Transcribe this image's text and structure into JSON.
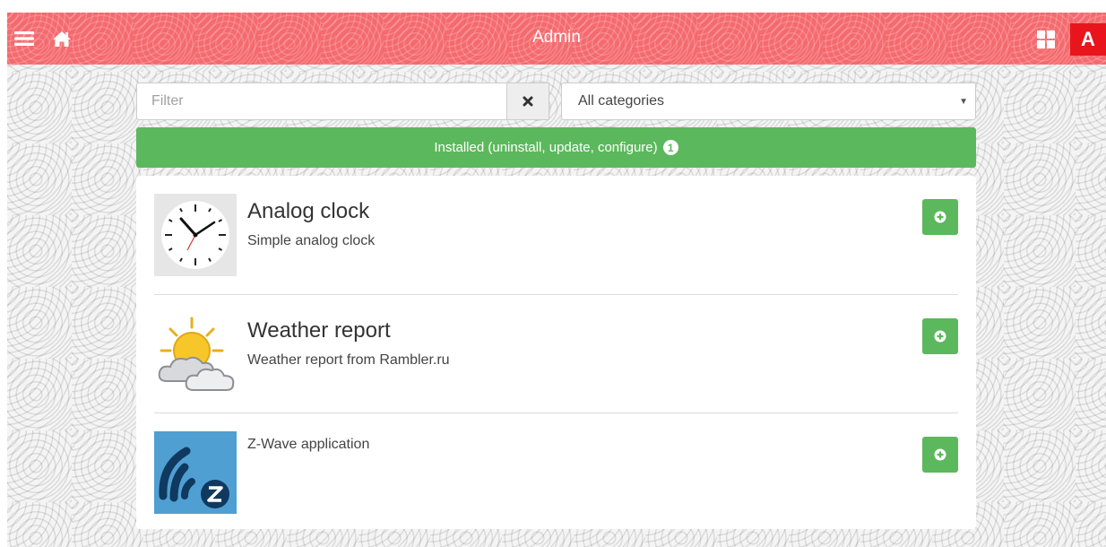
{
  "header": {
    "title": "Admin",
    "menu_icon": "hamburger-menu-icon",
    "home_icon": "home-icon",
    "grid_icon": "grid-icon",
    "admin_badge": "A",
    "accent_color": "#f46a6e",
    "badge_color": "#e8161c"
  },
  "filter": {
    "placeholder": "Filter",
    "value": "",
    "clear_icon": "close-icon"
  },
  "category": {
    "selected": "All categories"
  },
  "installed": {
    "label": "Installed (uninstall, update, configure)",
    "count": "1",
    "color": "#5cb85c"
  },
  "apps": [
    {
      "title": "Analog clock",
      "description": "Simple analog clock",
      "icon": "analog-clock-icon"
    },
    {
      "title": "Weather report",
      "description": "Weather report from Rambler.ru",
      "icon": "weather-icon"
    },
    {
      "title": "",
      "description": "Z-Wave application",
      "icon": "z-wave-icon"
    }
  ],
  "add_icon": "plus-circle-icon"
}
